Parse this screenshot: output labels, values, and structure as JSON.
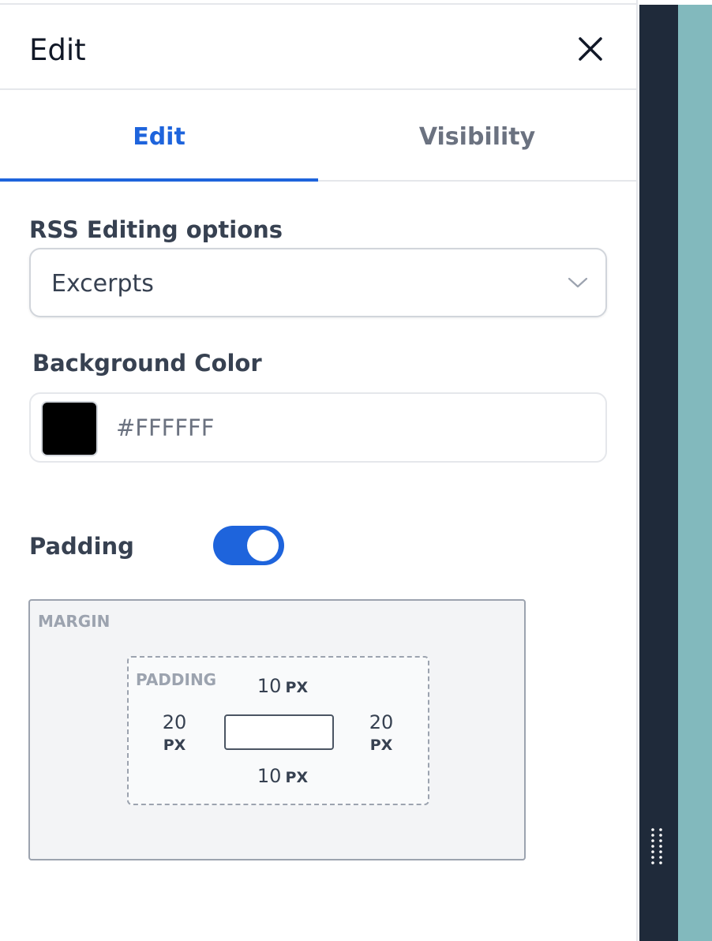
{
  "header": {
    "title": "Edit",
    "close_icon": "close-icon"
  },
  "tabs": [
    {
      "label": "Edit",
      "active": true
    },
    {
      "label": "Visibility",
      "active": false
    }
  ],
  "rss_options": {
    "label": "RSS Editing options",
    "selected": "Excerpts",
    "icon": "chevron-down-icon"
  },
  "background_color": {
    "label": "Background Color",
    "swatch_color": "#000000",
    "value": "#FFFFFF"
  },
  "padding_toggle": {
    "label": "Padding",
    "enabled": true
  },
  "spacing": {
    "margin_label": "MARGIN",
    "padding_label": "PADDING",
    "top": {
      "value": "10",
      "unit": "PX"
    },
    "bottom": {
      "value": "10",
      "unit": "PX"
    },
    "left": {
      "value": "20",
      "unit": "PX"
    },
    "right": {
      "value": "20",
      "unit": "PX"
    }
  },
  "colors": {
    "accent": "#1e64dc",
    "sidebar_dark": "#1f2a3a",
    "sidebar_teal": "#82b9bd"
  },
  "drag_handle_icon": "drag-handle-icon"
}
